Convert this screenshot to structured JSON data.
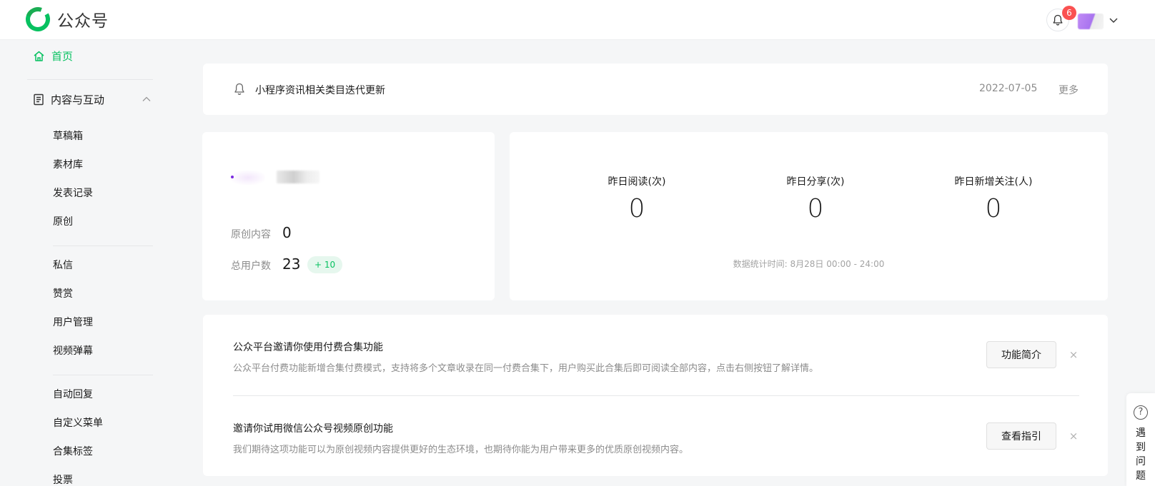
{
  "header": {
    "app_name": "公众号",
    "notification_count": "6"
  },
  "sidebar": {
    "home_label": "首页",
    "group_label": "内容与互动",
    "sections": [
      [
        "草稿箱",
        "素材库",
        "发表记录",
        "原创"
      ],
      [
        "私信",
        "赞赏",
        "用户管理",
        "视频弹幕"
      ],
      [
        "自动回复",
        "自定义菜单",
        "合集标签",
        "投票"
      ]
    ]
  },
  "notice": {
    "title": "小程序资讯相关类目迭代更新",
    "date": "2022-07-05",
    "more_label": "更多"
  },
  "account": {
    "original_label": "原创内容",
    "original_value": "0",
    "users_label": "总用户数",
    "users_value": "23",
    "users_growth": "+ 10"
  },
  "stats": {
    "metrics": [
      {
        "label": "昨日阅读(次)",
        "value": "0"
      },
      {
        "label": "昨日分享(次)",
        "value": "0"
      },
      {
        "label": "昨日新增关注(人)",
        "value": "0"
      }
    ],
    "footnote": "数据统计时间: 8月28日 00:00 - 24:00"
  },
  "invites": [
    {
      "title": "公众平台邀请你使用付费合集功能",
      "desc": "公众平台付费功能新增合集付费模式，支持将多个文章收录在同一付费合集下，用户购买此合集后即可阅读全部内容，点击右侧按钮了解详情。",
      "button": "功能简介",
      "close": "×"
    },
    {
      "title": "邀请你试用微信公众号视频原创功能",
      "desc": "我们期待这项功能可以为原创视频内容提供更好的生态环境，也期待你能为用户带来更多的优质原创视频内容。",
      "button": "查看指引",
      "close": "×"
    }
  ],
  "help": {
    "icon_glyph": "?",
    "label_chars": [
      "遇",
      "到",
      "问",
      "题"
    ]
  },
  "colors": {
    "brand_green": "#07c160",
    "badge_red": "#fa5151"
  }
}
